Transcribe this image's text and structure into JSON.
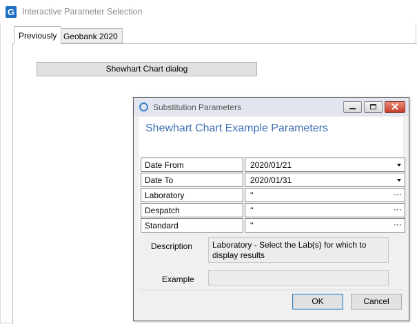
{
  "window": {
    "title": "Interactive Parameter Selection",
    "icon_letter": "G"
  },
  "tabs": [
    {
      "label": "Previously",
      "active": true
    },
    {
      "label": "Geobank 2020",
      "active": false
    }
  ],
  "main": {
    "dialog_button_label": "Shewhart Chart dialog"
  },
  "dialog": {
    "title": "Substitution Parameters",
    "heading": "Shewhart Chart Example Parameters",
    "window_buttons": [
      "minimize-icon",
      "maximize-icon",
      "close-icon"
    ],
    "params": [
      {
        "label": "Date From",
        "value": "2020/01/21",
        "control": "dropdown"
      },
      {
        "label": "Date To",
        "value": "2020/01/31",
        "control": "dropdown"
      },
      {
        "label": "Laboratory",
        "value": "''",
        "control": "ellipsis"
      },
      {
        "label": "Despatch",
        "value": "''",
        "control": "ellipsis"
      },
      {
        "label": "Standard",
        "value": "''",
        "control": "ellipsis"
      }
    ],
    "description_label": "Description",
    "description_text": "Laboratory - Select the Lab(s) for which to display results",
    "example_label": "Example",
    "example_text": "",
    "ok_label": "OK",
    "cancel_label": "Cancel",
    "ellipsis_glyph": "···",
    "colors": {
      "heading": "#3f6fb5",
      "app_icon": "#1f6fc5",
      "close_button": "#c7402b"
    }
  }
}
